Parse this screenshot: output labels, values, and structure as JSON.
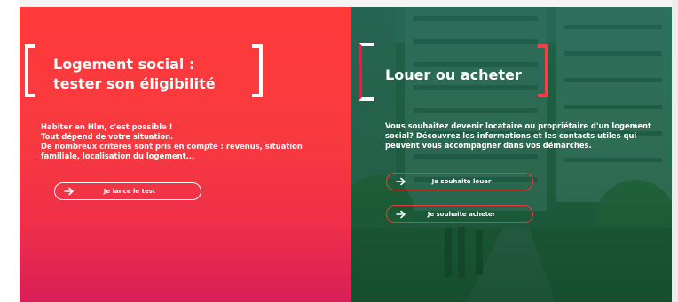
{
  "left": {
    "title_line1": "Logement social :",
    "title_line2": "tester son éligibilité",
    "desc_line1": "Habiter en Hlm, c'est possible !",
    "desc_line2": "Tout dépend de votre situation.",
    "desc_line3": "De nombreux critères sont pris en compte : revenus, situation",
    "desc_line4": "familiale, localisation du logement...",
    "cta_label": "Je lance le test"
  },
  "right": {
    "title": "Louer ou acheter",
    "desc_line1": "Vous souhaitez devenir locataire ou propriétaire d'un logement",
    "desc_line2": "social? Découvrez les informations et les contacts utiles qui",
    "desc_line3": "peuvent vous accompagner dans vos démarches.",
    "cta_rent_label": "Je souhaite louer",
    "cta_buy_label": "Je souhaite acheter"
  },
  "colors": {
    "left_panel_top": "#ff3a3a",
    "left_panel_bottom": "#d81f57",
    "right_overlay": "#1e5a3c",
    "accent_red": "#ff3b4a"
  },
  "icons": {
    "cta_arrow": "arrow-right-icon",
    "bracket": "bracket-icon"
  }
}
